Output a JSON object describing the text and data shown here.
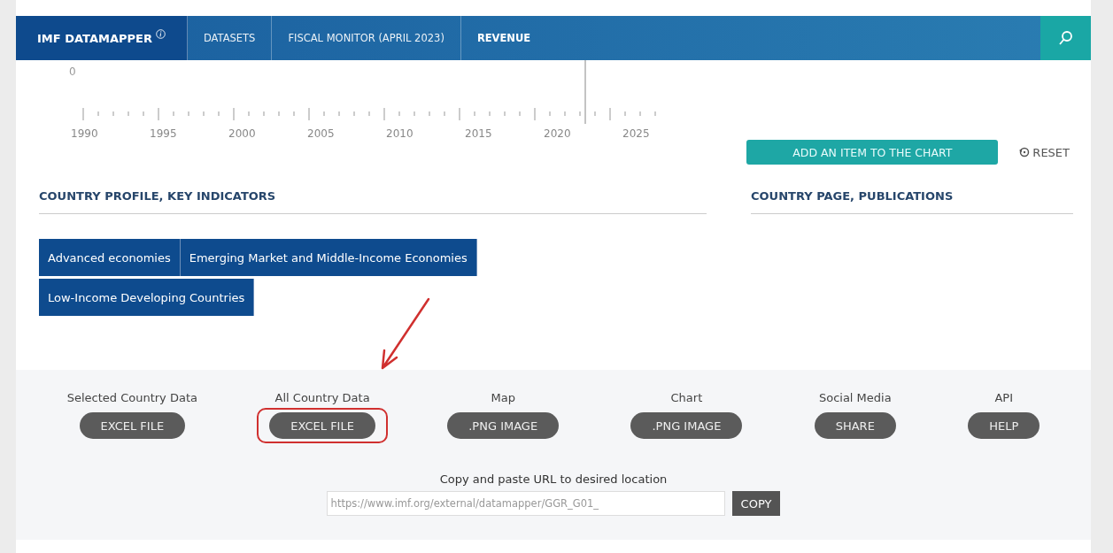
{
  "nav": {
    "tabs": [
      {
        "label": "IMF DATAMAPPER",
        "kind": "brand",
        "selected": false
      },
      {
        "label": "DATASETS",
        "kind": "crumb",
        "selected": false
      },
      {
        "label": "FISCAL MONITOR (APRIL 2023)",
        "kind": "crumb",
        "selected": false
      },
      {
        "label": "REVENUE",
        "kind": "current",
        "selected": true
      }
    ]
  },
  "timeline": {
    "zero_label": "0",
    "years": [
      "1990",
      "1995",
      "2000",
      "2005",
      "2010",
      "2015",
      "2020",
      "2025"
    ]
  },
  "add_item_button": "ADD AN ITEM TO THE CHART",
  "reset_button": "RESET",
  "left_section": {
    "heading": "COUNTRY PROFILE, KEY INDICATORS",
    "groups": [
      "Advanced economies",
      "Emerging Market and Middle-Income Economies",
      "Low-Income Developing Countries"
    ]
  },
  "right_section": {
    "heading": "COUNTRY PAGE, PUBLICATIONS"
  },
  "downloads": [
    {
      "label": "Selected Country Data",
      "button": "EXCEL FILE",
      "highlighted": false
    },
    {
      "label": "All Country Data",
      "button": "EXCEL FILE",
      "highlighted": true
    },
    {
      "label": "Map",
      "button": ".PNG IMAGE",
      "highlighted": false
    },
    {
      "label": "Chart",
      "button": ".PNG IMAGE",
      "highlighted": false
    },
    {
      "label": "Social Media",
      "button": "SHARE",
      "highlighted": false
    },
    {
      "label": "API",
      "button": "HELP",
      "highlighted": false
    }
  ],
  "url_share": {
    "label": "Copy and paste URL to desired location",
    "value": "https://www.imf.org/external/datamapper/GGR_G01_",
    "button": "COPY"
  }
}
